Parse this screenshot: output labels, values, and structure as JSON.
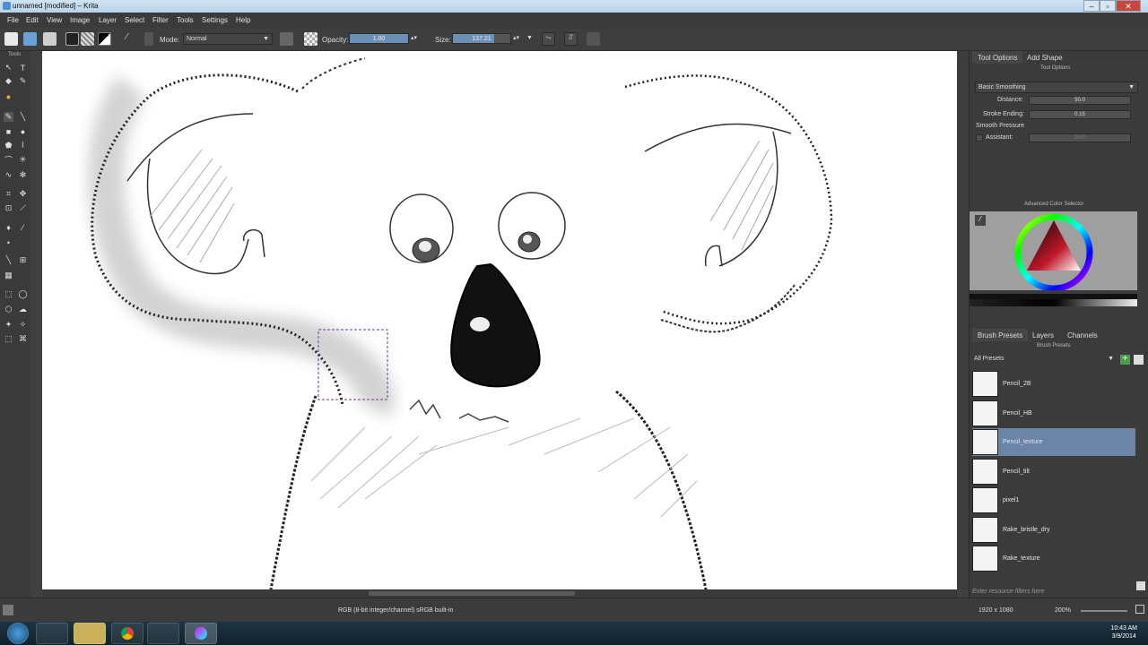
{
  "window": {
    "title": "unnamed [modified] – Krita"
  },
  "menu": [
    "File",
    "Edit",
    "View",
    "Image",
    "Layer",
    "Select",
    "Filter",
    "Tools",
    "Settings",
    "Help"
  ],
  "toolbar": {
    "mode_label": "Mode:",
    "mode_value": "Normal",
    "opacity_label": "Opacity:",
    "opacity_value": "1.00",
    "opacity_fraction": 1.0,
    "size_label": "Size:",
    "size_value": "137.21"
  },
  "toolbox": {
    "header": "Tools"
  },
  "docker": {
    "tabs": [
      "Tool Options",
      "Add Shape"
    ],
    "tool_options_title": "Tool Options",
    "smoothing": "Basic Smoothing",
    "distance_label": "Distance:",
    "distance_value": "50.0",
    "stroke_ending_label": "Stroke Ending:",
    "stroke_ending_value": "0.15",
    "smooth_pressure_label": "Smooth Pressure",
    "assistant_label": "Assistant:",
    "assistant_value": "1000",
    "color_selector_title": "Advanced Color Selector",
    "bottom_tabs": [
      "Brush Presets",
      "Layers",
      "Channels"
    ],
    "brush_presets_title": "Brush Presets",
    "filter_value": "All Presets",
    "presets": [
      "Pencil_2B",
      "Pencil_HB",
      "Pencil_texture",
      "Pencil_tilt",
      "pixel1",
      "Rake_bristle_dry",
      "Rake_texture"
    ],
    "selected_preset": "Pencil_texture",
    "filter_placeholder": "Enter resource filters here"
  },
  "status": {
    "color_space": "RGB (8-bit integer/channel)  sRGB built-in",
    "image_size": "1920 x 1080",
    "zoom": "200%"
  },
  "taskbar": {
    "time": "10:43 AM",
    "date": "3/9/2014"
  },
  "icons": [
    "krita-app-icon",
    "new-document-icon",
    "open-icon",
    "save-icon",
    "pattern-icon",
    "gradient-icon",
    "color-swatch-icon",
    "brush-settings-icon",
    "eraser-icon",
    "alpha-lock-icon",
    "mirror-x-icon",
    "mirror-y-icon",
    "workspace-icon",
    "start-icon",
    "chrome-icon",
    "krita-taskbar-icon"
  ],
  "colors": {
    "accent": "#6b84a8",
    "background": "#3b3b3b",
    "canvas": "#ffffff"
  }
}
